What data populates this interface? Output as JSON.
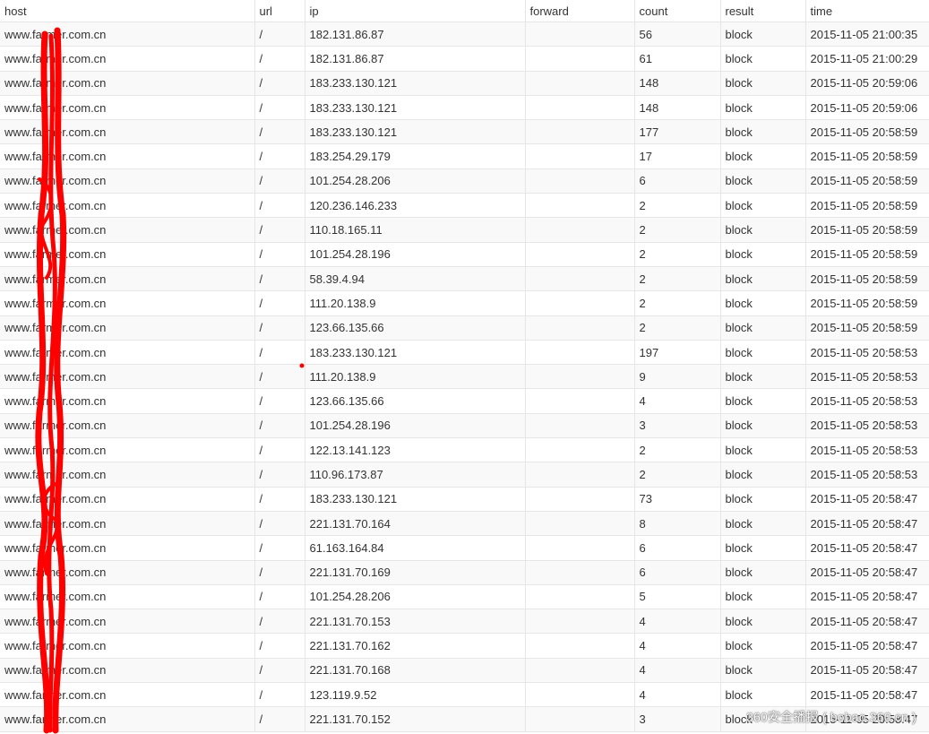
{
  "table": {
    "columns": [
      "host",
      "url",
      "ip",
      "forward",
      "count",
      "result",
      "time"
    ],
    "rows": [
      [
        "www.farmer.com.cn",
        "/",
        "182.131.86.87",
        "",
        "56",
        "block",
        "2015-11-05 21:00:35"
      ],
      [
        "www.farmer.com.cn",
        "/",
        "182.131.86.87",
        "",
        "61",
        "block",
        "2015-11-05 21:00:29"
      ],
      [
        "www.farmer.com.cn",
        "/",
        "183.233.130.121",
        "",
        "148",
        "block",
        "2015-11-05 20:59:06"
      ],
      [
        "www.farmer.com.cn",
        "/",
        "183.233.130.121",
        "",
        "148",
        "block",
        "2015-11-05 20:59:06"
      ],
      [
        "www.farmer.com.cn",
        "/",
        "183.233.130.121",
        "",
        "177",
        "block",
        "2015-11-05 20:58:59"
      ],
      [
        "www.farmer.com.cn",
        "/",
        "183.254.29.179",
        "",
        "17",
        "block",
        "2015-11-05 20:58:59"
      ],
      [
        "www.farmer.com.cn",
        "/",
        "101.254.28.206",
        "",
        "6",
        "block",
        "2015-11-05 20:58:59"
      ],
      [
        "www.farmer.com.cn",
        "/",
        "120.236.146.233",
        "",
        "2",
        "block",
        "2015-11-05 20:58:59"
      ],
      [
        "www.farmer.com.cn",
        "/",
        "110.18.165.11",
        "",
        "2",
        "block",
        "2015-11-05 20:58:59"
      ],
      [
        "www.farmer.com.cn",
        "/",
        "101.254.28.196",
        "",
        "2",
        "block",
        "2015-11-05 20:58:59"
      ],
      [
        "www.farmer.com.cn",
        "/",
        "58.39.4.94",
        "",
        "2",
        "block",
        "2015-11-05 20:58:59"
      ],
      [
        "www.farmer.com.cn",
        "/",
        "111.20.138.9",
        "",
        "2",
        "block",
        "2015-11-05 20:58:59"
      ],
      [
        "www.farmer.com.cn",
        "/",
        "123.66.135.66",
        "",
        "2",
        "block",
        "2015-11-05 20:58:59"
      ],
      [
        "www.farmer.com.cn",
        "/",
        "183.233.130.121",
        "",
        "197",
        "block",
        "2015-11-05 20:58:53"
      ],
      [
        "www.farmer.com.cn",
        "/",
        "111.20.138.9",
        "",
        "9",
        "block",
        "2015-11-05 20:58:53"
      ],
      [
        "www.farmer.com.cn",
        "/",
        "123.66.135.66",
        "",
        "4",
        "block",
        "2015-11-05 20:58:53"
      ],
      [
        "www.farmer.com.cn",
        "/",
        "101.254.28.196",
        "",
        "3",
        "block",
        "2015-11-05 20:58:53"
      ],
      [
        "www.farmer.com.cn",
        "/",
        "122.13.141.123",
        "",
        "2",
        "block",
        "2015-11-05 20:58:53"
      ],
      [
        "www.farmer.com.cn",
        "/",
        "110.96.173.87",
        "",
        "2",
        "block",
        "2015-11-05 20:58:53"
      ],
      [
        "www.farmer.com.cn",
        "/",
        "183.233.130.121",
        "",
        "73",
        "block",
        "2015-11-05 20:58:47"
      ],
      [
        "www.farmer.com.cn",
        "/",
        "221.131.70.164",
        "",
        "8",
        "block",
        "2015-11-05 20:58:47"
      ],
      [
        "www.farmer.com.cn",
        "/",
        "61.163.164.84",
        "",
        "6",
        "block",
        "2015-11-05 20:58:47"
      ],
      [
        "www.farmer.com.cn",
        "/",
        "221.131.70.169",
        "",
        "6",
        "block",
        "2015-11-05 20:58:47"
      ],
      [
        "www.farmer.com.cn",
        "/",
        "101.254.28.206",
        "",
        "5",
        "block",
        "2015-11-05 20:58:47"
      ],
      [
        "www.farmer.com.cn",
        "/",
        "221.131.70.153",
        "",
        "4",
        "block",
        "2015-11-05 20:58:47"
      ],
      [
        "www.farmer.com.cn",
        "/",
        "221.131.70.162",
        "",
        "4",
        "block",
        "2015-11-05 20:58:47"
      ],
      [
        "www.farmer.com.cn",
        "/",
        "221.131.70.168",
        "",
        "4",
        "block",
        "2015-11-05 20:58:47"
      ],
      [
        "www.farmer.com.cn",
        "/",
        "123.119.9.52",
        "",
        "4",
        "block",
        "2015-11-05 20:58:47"
      ],
      [
        "www.farmer.com.cn",
        "/",
        "221.131.70.152",
        "",
        "3",
        "block",
        "2015-11-05 20:58:47"
      ]
    ]
  },
  "colors": {
    "stripe": "#f9f9f9",
    "grid": "#e6e6e6",
    "text": "#333333",
    "redaction": "#ff0000"
  },
  "watermark": "360安全播报 ( bobao.360.cn )"
}
